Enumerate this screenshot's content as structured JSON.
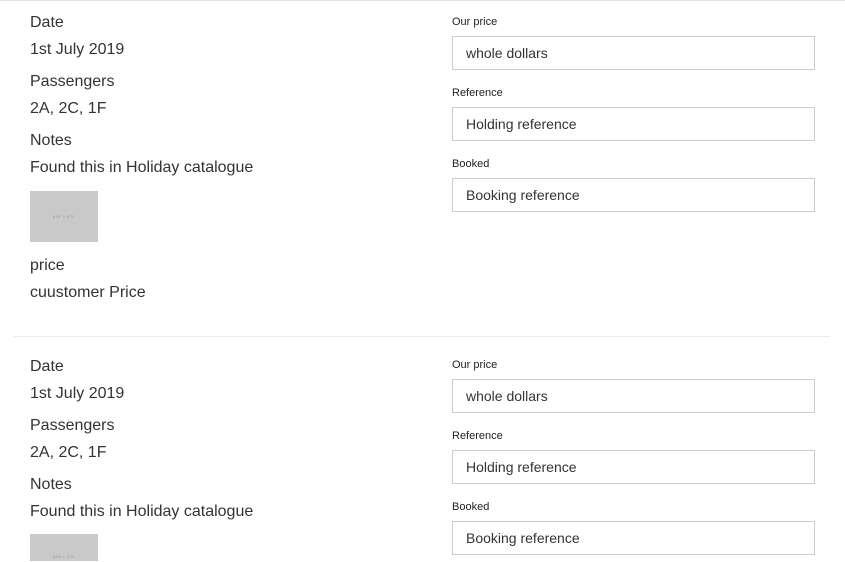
{
  "labels": {
    "date": "Date",
    "passengers": "Passengers",
    "notes": "Notes",
    "price": "price",
    "our_price": "Our price",
    "reference": "Reference",
    "booked": "Booked"
  },
  "cards": [
    {
      "date": "1st July 2019",
      "passengers": "2A, 2C, 1F",
      "notes": "Found this in Holiday catalogue",
      "image_text": "896 x 672",
      "price": "cuustomer Price",
      "our_price_value": "whole dollars",
      "reference_value": "Holding reference",
      "booked_value": "Booking reference"
    },
    {
      "date": "1st July 2019",
      "passengers": "2A, 2C, 1F",
      "notes": "Found this in Holiday catalogue",
      "image_text": "896 x 672",
      "our_price_value": "whole dollars",
      "reference_value": "Holding reference",
      "booked_value": "Booking reference"
    }
  ]
}
